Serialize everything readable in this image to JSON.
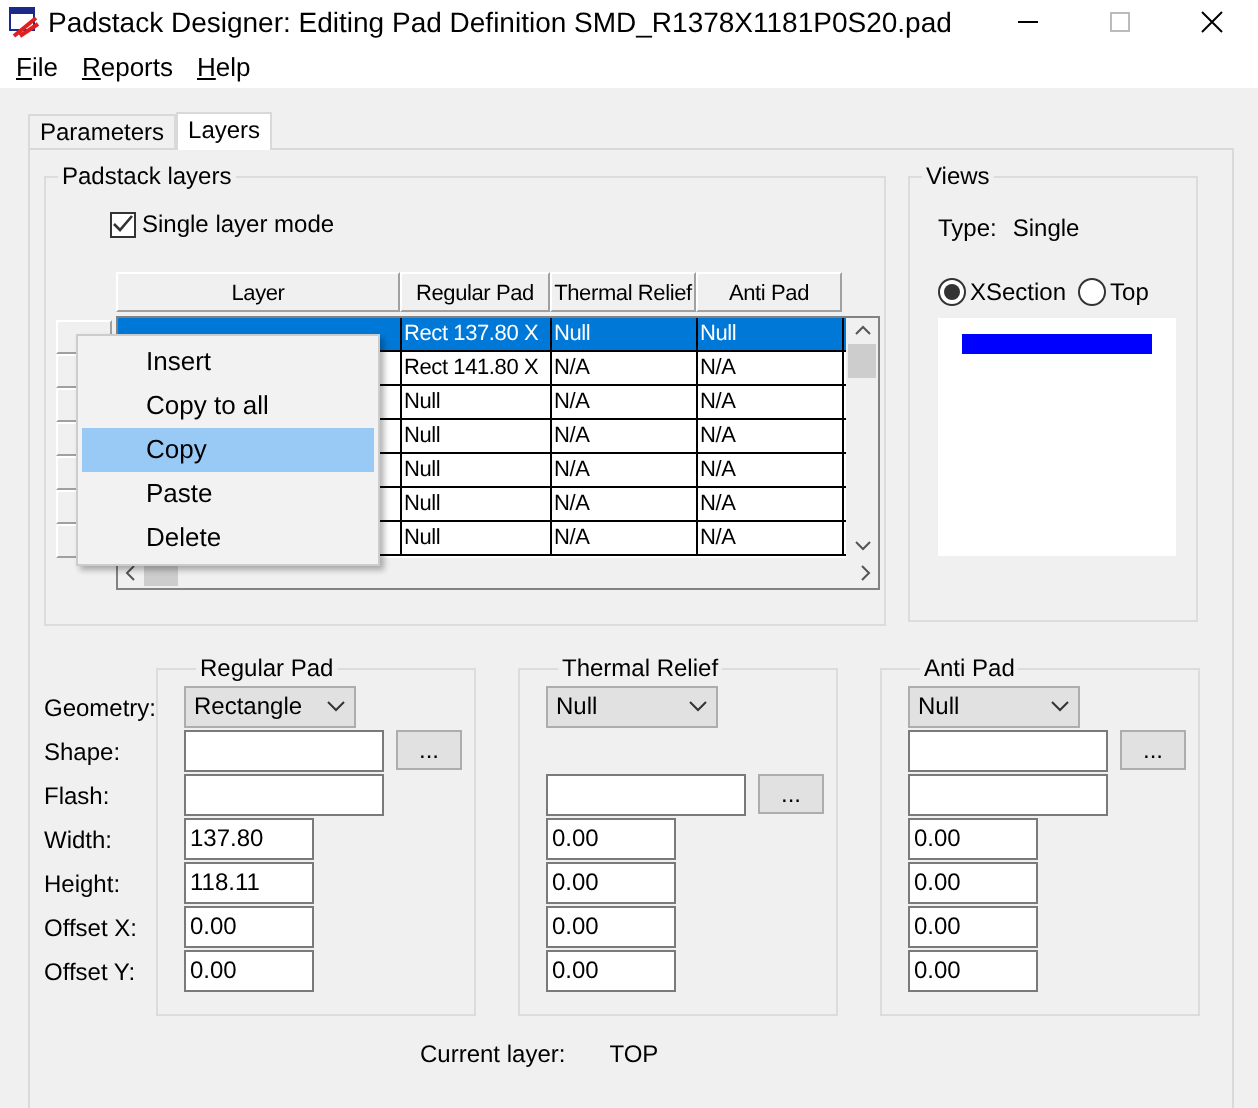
{
  "window": {
    "title": "Padstack Designer: Editing Pad Definition SMD_R1378X1181P0S20.pad"
  },
  "menu": [
    "File",
    "Reports",
    "Help"
  ],
  "tabs": [
    {
      "label": "Parameters",
      "selected": false
    },
    {
      "label": "Layers",
      "selected": true
    }
  ],
  "padstack_layers": {
    "title": "Padstack layers",
    "single_layer_mode": {
      "label": "Single layer mode",
      "checked": true
    },
    "columns": [
      "Layer",
      "Regular Pad",
      "Thermal Relief",
      "Anti Pad"
    ],
    "rows": [
      {
        "regular_pad": "Rect 137.80 X",
        "thermal_relief": "Null",
        "anti_pad": "Null",
        "selected": true
      },
      {
        "regular_pad": "Rect 141.80 X",
        "thermal_relief": "N/A",
        "anti_pad": "N/A",
        "selected": false
      },
      {
        "regular_pad": "Null",
        "thermal_relief": "N/A",
        "anti_pad": "N/A",
        "selected": false
      },
      {
        "regular_pad": "Null",
        "thermal_relief": "N/A",
        "anti_pad": "N/A",
        "selected": false
      },
      {
        "regular_pad": "Null",
        "thermal_relief": "N/A",
        "anti_pad": "N/A",
        "selected": false
      },
      {
        "regular_pad": "Null",
        "thermal_relief": "N/A",
        "anti_pad": "N/A",
        "selected": false
      },
      {
        "regular_pad": "Null",
        "thermal_relief": "N/A",
        "anti_pad": "N/A",
        "selected": false
      }
    ]
  },
  "context_menu": [
    {
      "label": "Insert",
      "selected": false
    },
    {
      "label": "Copy to all",
      "selected": false
    },
    {
      "label": "Copy",
      "selected": true
    },
    {
      "label": "Paste",
      "selected": false
    },
    {
      "label": "Delete",
      "selected": false
    }
  ],
  "views": {
    "title": "Views",
    "type_label": "Type:",
    "type_value": "Single",
    "options": [
      {
        "label": "XSection",
        "selected": true
      },
      {
        "label": "Top",
        "selected": false
      }
    ]
  },
  "field_labels": [
    "Geometry:",
    "Shape:",
    "Flash:",
    "Width:",
    "Height:",
    "Offset X:",
    "Offset Y:"
  ],
  "pads": [
    {
      "title": "Regular Pad",
      "geometry": "Rectangle",
      "shape": {
        "kind": "field",
        "button": "..."
      },
      "flash": {
        "kind": "field"
      },
      "values": [
        "137.80",
        "118.11",
        "0.00",
        "0.00"
      ]
    },
    {
      "title": "Thermal Relief",
      "geometry": "Null",
      "shape": {
        "kind": "blank"
      },
      "flash": {
        "kind": "field",
        "button": "..."
      },
      "values": [
        "0.00",
        "0.00",
        "0.00",
        "0.00"
      ]
    },
    {
      "title": "Anti Pad",
      "geometry": "Null",
      "shape": {
        "kind": "field",
        "button": "..."
      },
      "flash": {
        "kind": "field"
      },
      "values": [
        "0.00",
        "0.00",
        "0.00",
        "0.00"
      ]
    }
  ],
  "current_layer": {
    "label": "Current layer:",
    "value": "TOP"
  }
}
